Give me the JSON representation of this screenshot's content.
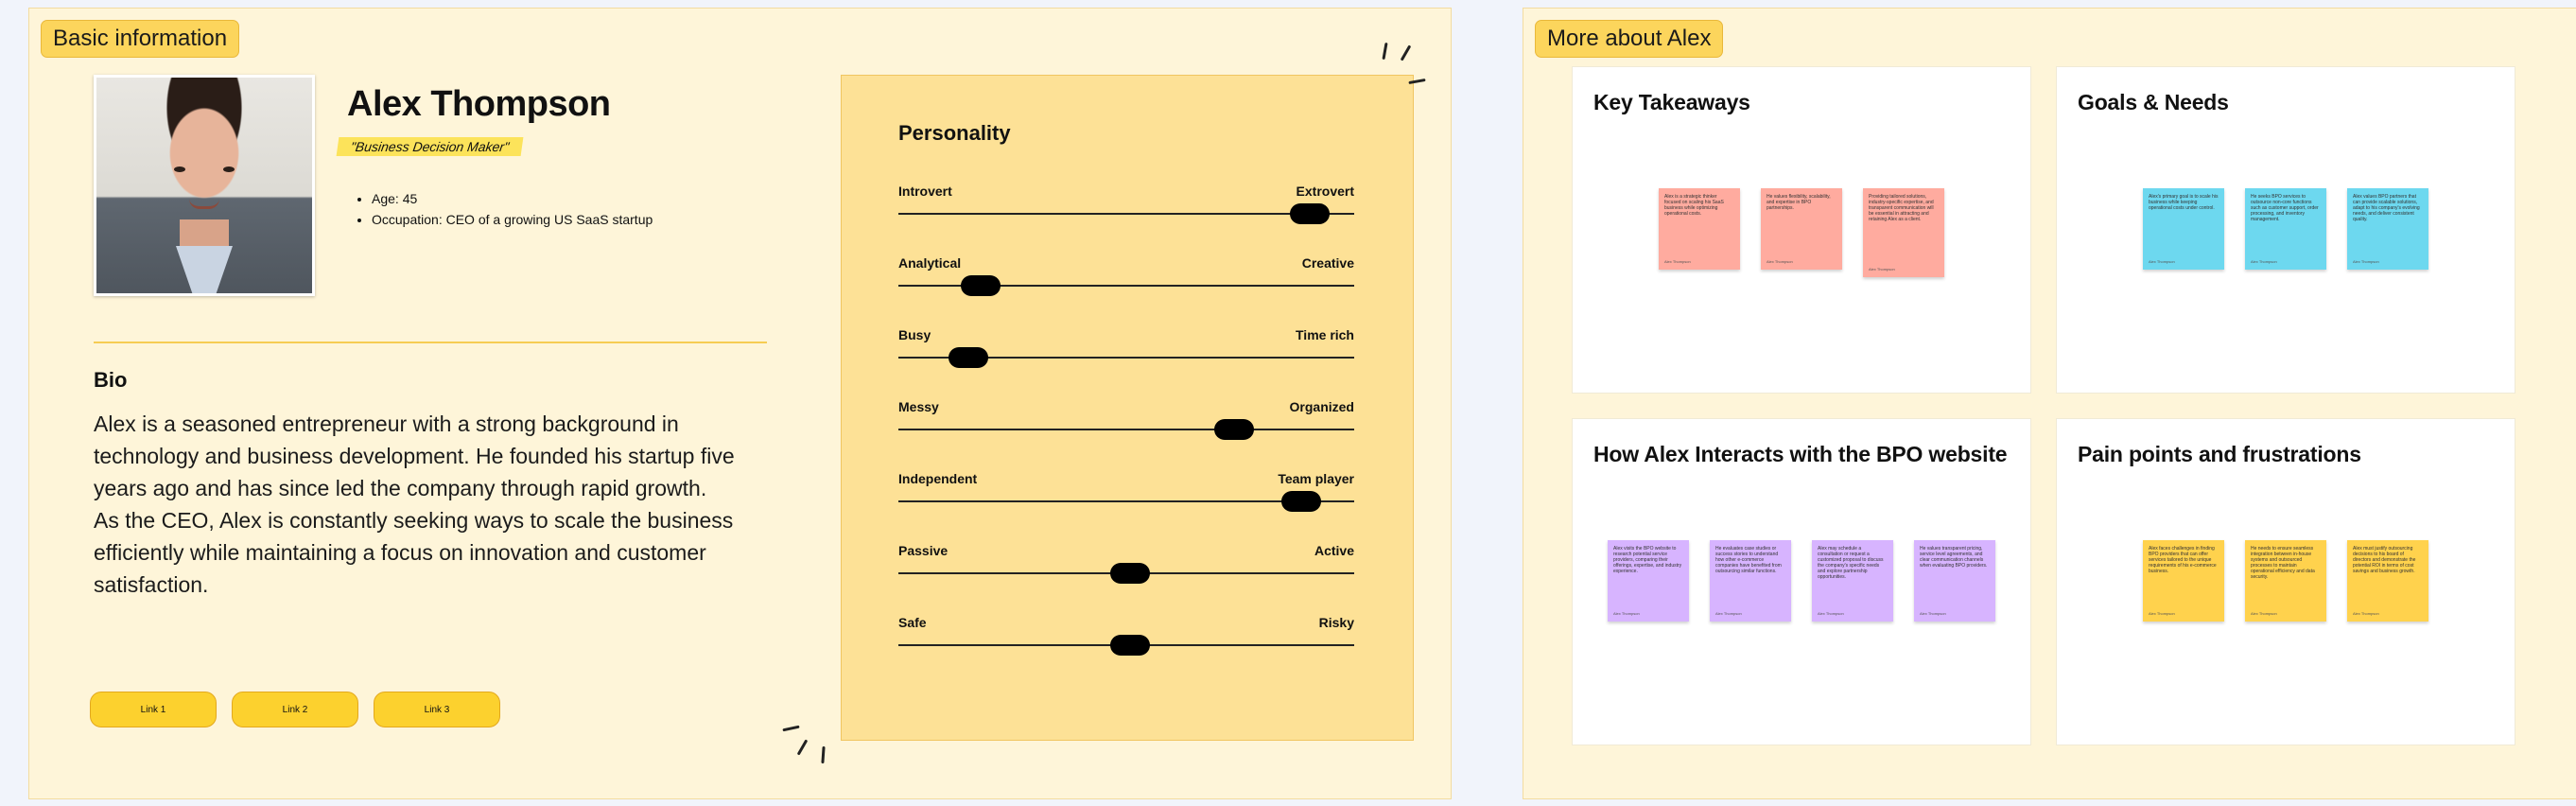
{
  "basic": {
    "tag": "Basic information",
    "name": "Alex Thompson",
    "role": "\"Business Decision Maker\"",
    "facts": [
      "Age: 45",
      "Occupation: CEO of a growing US SaaS startup"
    ],
    "bio_title": "Bio",
    "bio_text": "Alex is a seasoned entrepreneur with a strong background in technology and business development. He founded his startup five years ago and has since led the company through rapid growth. As the CEO, Alex is constantly seeking ways to scale the business efficiently while maintaining a focus on innovation and customer satisfaction.",
    "links": [
      "Link 1",
      "Link 2",
      "Link 3"
    ]
  },
  "personality": {
    "title": "Personality",
    "traits": [
      {
        "left": "Introvert",
        "right": "Extrovert",
        "value": 0.94
      },
      {
        "left": "Analytical",
        "right": "Creative",
        "value": 0.15
      },
      {
        "left": "Busy",
        "right": "Time rich",
        "value": 0.12
      },
      {
        "left": "Messy",
        "right": "Organized",
        "value": 0.76
      },
      {
        "left": "Independent",
        "right": "Team player",
        "value": 0.92
      },
      {
        "left": "Passive",
        "right": "Active",
        "value": 0.51
      },
      {
        "left": "Safe",
        "right": "Risky",
        "value": 0.51
      }
    ]
  },
  "more": {
    "tag": "More about Alex",
    "cards": [
      {
        "title": "Key Takeaways",
        "color": "#ffab9f",
        "notes": [
          {
            "text": "Alex is a strategic thinker focused on scaling his SaaS business while optimizing operational costs.",
            "author": "Alex Thompson"
          },
          {
            "text": "He values flexibility, scalability, and expertise in BPO partnerships.",
            "author": "Alex Thompson"
          },
          {
            "text": "Providing tailored solutions, industry-specific expertise, and transparent communication will be essential in attracting and retaining Alex as a client.",
            "author": "Alex Thompson"
          }
        ]
      },
      {
        "title": "Goals & Needs",
        "color": "#6dd8ef",
        "notes": [
          {
            "text": "Alex's primary goal is to scale his business while keeping operational costs under control.",
            "author": "Alex Thompson"
          },
          {
            "text": "He seeks BPO services to outsource non-core functions such as customer support, order processing, and inventory management.",
            "author": "Alex Thompson"
          },
          {
            "text": "Alex values BPO partners that can provide scalable solutions, adapt to his company's evolving needs, and deliver consistent quality.",
            "author": "Alex Thompson"
          }
        ]
      },
      {
        "title": "How Alex Interacts with the BPO website",
        "color": "#d7b4ff",
        "notes": [
          {
            "text": "Alex visits the BPO website to research potential service providers, comparing their offerings, expertise, and industry experience.",
            "author": "Alex Thompson"
          },
          {
            "text": "He evaluates case studies or success stories to understand how other e-commerce companies have benefited from outsourcing similar functions.",
            "author": "Alex Thompson"
          },
          {
            "text": "Alex may schedule a consultation or request a customized proposal to discuss the company's specific needs and explore partnership opportunities.",
            "author": "Alex Thompson"
          },
          {
            "text": "He values transparent pricing, service level agreements, and clear communication channels when evaluating BPO providers.",
            "author": "Alex Thompson"
          }
        ]
      },
      {
        "title": "Pain points and frustrations",
        "color": "#ffd24d",
        "notes": [
          {
            "text": "Alex faces challenges in finding BPO providers that can offer services tailored to the unique requirements of his e-commerce business.",
            "author": "Alex Thompson"
          },
          {
            "text": "He needs to ensure seamless integration between in-house systems and outsourced processes to maintain operational efficiency and data security.",
            "author": "Alex Thompson"
          },
          {
            "text": "Alex must justify outsourcing decisions to his board of directors and demonstrate the potential ROI in terms of cost savings and business growth.",
            "author": "Alex Thompson"
          }
        ]
      }
    ]
  }
}
